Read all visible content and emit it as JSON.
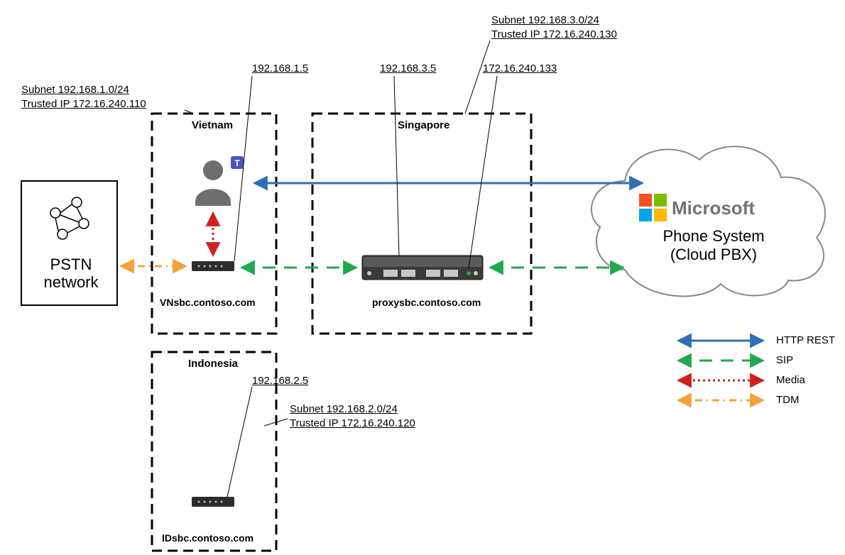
{
  "sites": {
    "vietnam": {
      "title": "Vietnam",
      "subnet": "Subnet 192.168.1.0/24",
      "trusted": "Trusted IP 172.16.240.110",
      "sbc_ip": "192.168.1.5",
      "sbc_host": "VNsbc.contoso.com"
    },
    "singapore": {
      "title": "Singapore",
      "subnet": "Subnet 192.168.3.0/24",
      "trusted": "Trusted IP 172.16.240.130",
      "sbc_ip": "192.168.3.5",
      "public_ip": "172.16.240.133",
      "sbc_host": "proxysbc.contoso.com"
    },
    "indonesia": {
      "title": "Indonesia",
      "subnet": "Subnet 192.168.2.0/24",
      "trusted": "Trusted IP 172.16.240.120",
      "sbc_ip": "192.168.2.5",
      "sbc_host": "IDsbc.contoso.com"
    }
  },
  "pstn": {
    "line1": "PSTN",
    "line2": "network"
  },
  "cloud": {
    "brand": "Microsoft",
    "line1": "Phone System",
    "line2": "(Cloud PBX)"
  },
  "legend": {
    "http": "HTTP REST",
    "sip": "SIP",
    "media": "Media",
    "tdm": "TDM"
  },
  "colors": {
    "http": "#2f6fb3",
    "sip": "#1fa94d",
    "media": "#d01f1f",
    "tdm": "#f2a23a",
    "ms_red": "#f25022",
    "ms_green": "#7fba00",
    "ms_blue": "#00a4ef",
    "ms_yellow": "#ffb900",
    "ms_gray": "#737373",
    "teams": "#4b53bc"
  }
}
